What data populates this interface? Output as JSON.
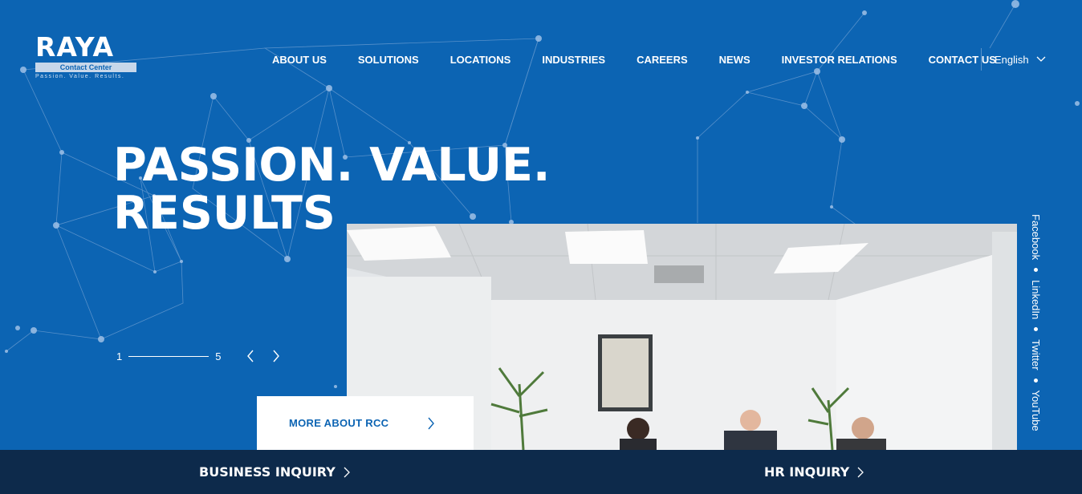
{
  "logo": {
    "word": "RAYA",
    "sub": "Contact Center",
    "tagline": "Passion. Value. Results."
  },
  "nav": {
    "items": [
      "ABOUT US",
      "SOLUTIONS",
      "LOCATIONS",
      "INDUSTRIES",
      "CAREERS",
      "NEWS",
      "INVESTOR RELATIONS",
      "CONTACT US"
    ],
    "language": "English"
  },
  "hero": {
    "headline_line1": "PASSION. VALUE.",
    "headline_line2": "RESULTS",
    "slide_current": "1",
    "slide_total": "5",
    "more_label": "MORE ABOUT RCC"
  },
  "social": [
    "Facebook",
    "LinkedIn",
    "Twitter",
    "YouTube"
  ],
  "bottom": {
    "business_label": "BUSINESS INQUIRY",
    "hr_label": "HR INQUIRY"
  },
  "colors": {
    "hero_bg": "#0c64b3",
    "bottom_bar": "#0d2a4b",
    "accent_text": "#0c64b3"
  }
}
